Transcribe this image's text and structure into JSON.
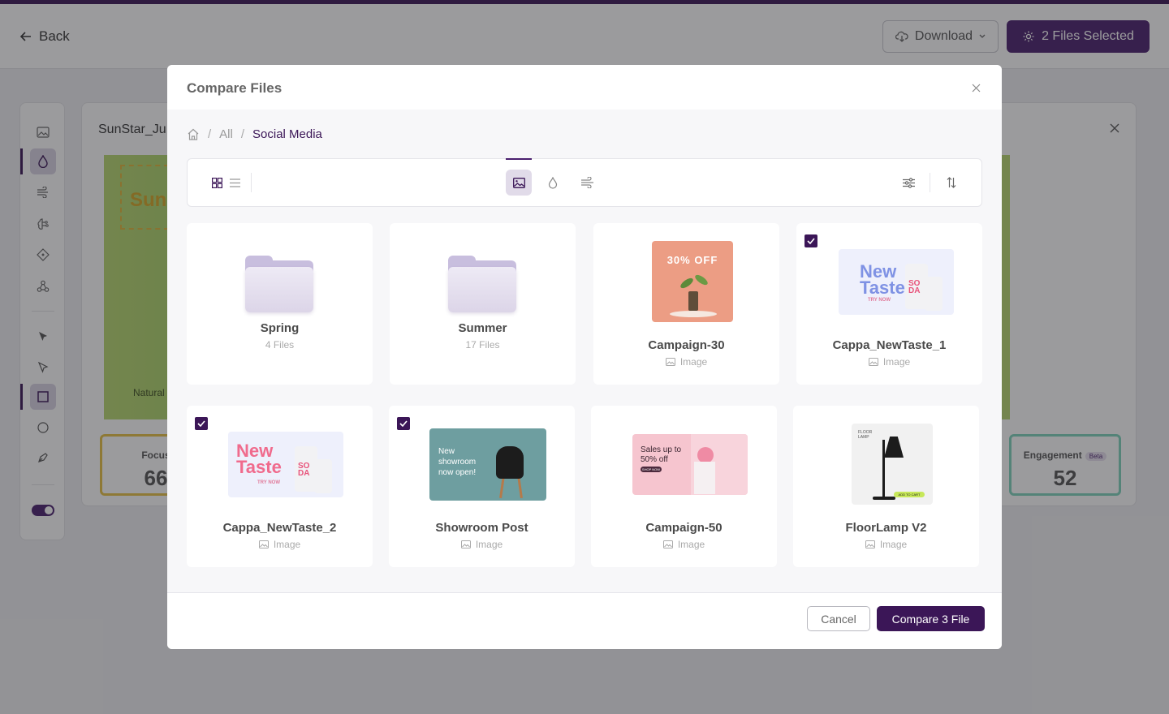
{
  "app": {
    "back_label": "Back",
    "download_label": "Download",
    "selected_label": "2 Files Selected",
    "panel_title": "SunStar_Ju",
    "image_caption": "Natural",
    "logo_text": "Sun",
    "metrics": [
      {
        "label": "Focus",
        "value": "66"
      },
      {
        "label": "Engagement",
        "value": "52",
        "badge": "Beta"
      }
    ],
    "rail_icons": [
      "image-icon",
      "drop-icon",
      "wind-icon",
      "brain-icon",
      "diamond-icon",
      "nodes-icon",
      "cursor-filled-icon",
      "cursor-outline-icon",
      "square-icon",
      "circle-icon",
      "pen-icon",
      "toggle-switch"
    ]
  },
  "modal": {
    "title": "Compare Files",
    "breadcrumb": [
      "All",
      "Social Media"
    ],
    "view_modes": [
      "grid-view-icon",
      "list-view-icon"
    ],
    "filters": [
      "image-filter-icon",
      "drop-filter-icon",
      "wind-filter-icon"
    ],
    "actions": [
      "settings-sliders-icon",
      "sort-icon"
    ],
    "folders": [
      {
        "name": "Spring",
        "count": "4 Files"
      },
      {
        "name": "Summer",
        "count": "17 Files"
      }
    ],
    "files": [
      {
        "name": "Campaign-30",
        "type": "Image",
        "checked": false,
        "thumb_text": "30% OFF"
      },
      {
        "name": "Cappa_NewTaste_1",
        "type": "Image",
        "checked": true,
        "thumb_text": "New Taste"
      },
      {
        "name": "Cappa_NewTaste_2",
        "type": "Image",
        "checked": true,
        "thumb_text": "New Taste"
      },
      {
        "name": "Showroom Post",
        "type": "Image",
        "checked": true,
        "thumb_text": "New showroom now open!"
      },
      {
        "name": "Campaign-50",
        "type": "Image",
        "checked": false,
        "thumb_text": "Sales up to 50% off"
      },
      {
        "name": "FloorLamp V2",
        "type": "Image",
        "checked": false,
        "thumb_text": "FLOOR LAMP"
      }
    ],
    "thumb_extras": {
      "try_now": "TRY NOW",
      "soda": "SO DA",
      "shop_now": "SHOP NOW",
      "add_to_cart": "ADD TO CART"
    },
    "cancel_label": "Cancel",
    "compare_label": "Compare 3 File"
  },
  "colors": {
    "brand": "#3b1657",
    "accent_light": "#e1dbe9"
  }
}
